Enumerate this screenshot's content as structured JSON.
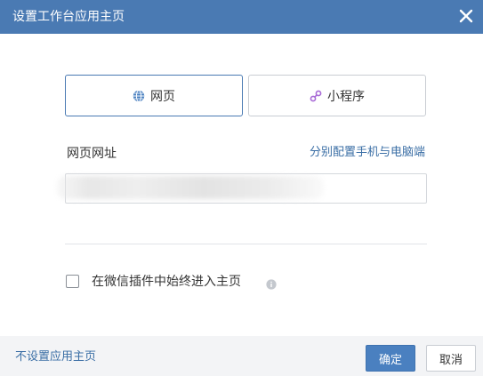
{
  "dialog": {
    "title": "设置工作台应用主页",
    "close_icon": "close-icon"
  },
  "tabs": {
    "web": {
      "label": "网页",
      "icon": "globe-icon",
      "active": true
    },
    "miniprogram": {
      "label": "小程序",
      "icon": "link-icon",
      "active": false
    }
  },
  "url": {
    "label": "网页网址",
    "split_link": "分别配置手机与电脑端",
    "value": ""
  },
  "option": {
    "label": "在微信插件中始终进入主页",
    "checked": false,
    "info_icon": "info-icon"
  },
  "footer": {
    "no_home_link": "不设置应用主页",
    "ok_label": "确定",
    "cancel_label": "取消"
  },
  "colors": {
    "titlebar": "#4a7ab3",
    "accent": "#4a80c0",
    "link": "#3a6ea5",
    "miniprogram_icon": "#a86ad6"
  }
}
